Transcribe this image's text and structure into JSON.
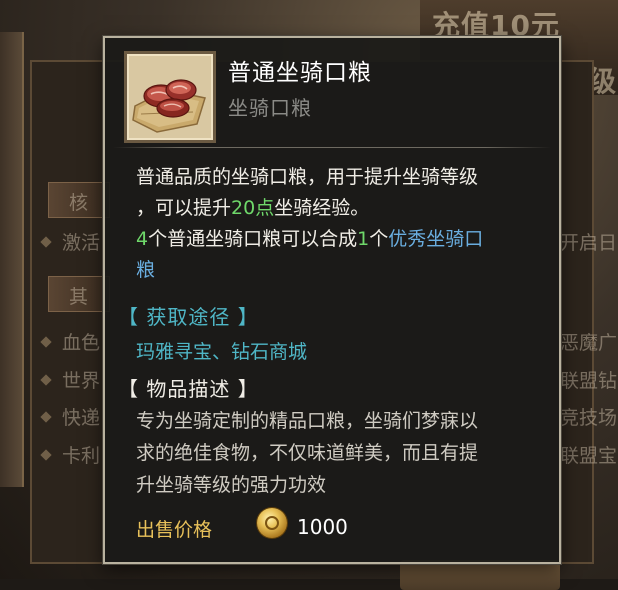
{
  "tooltip": {
    "name": "普通坐骑口粮",
    "type": "坐骑口粮",
    "description": {
      "line1": "普通品质的坐骑口粮，用于提升坐骑等级",
      "line2_pre": "，可以提升",
      "line2_points": "20点",
      "line2_post": "坐骑经验。",
      "line3_count_a": "4",
      "line3_mid": "个普通坐骑口粮可以合成",
      "line3_count_b": "1",
      "line3_unit": "个",
      "line3_link": "优秀坐骑口",
      "line4_link": "粮"
    },
    "acquire_heading": "【 获取途径 】",
    "acquire_sources": "玛雅寻宝、钻石商城",
    "item_desc_heading": "【 物品描述 】",
    "flavor_lines": [
      "专为坐骑定制的精品口粮，坐骑们梦寐以",
      "求的绝佳食物，不仅味道鲜美，而且有提",
      "升坐骑等级的强力功效"
    ],
    "price_label": "出售价格",
    "price_value": "1000",
    "icons": {
      "item": "meat-ration-icon",
      "currency": "gold-coin-icon"
    },
    "colors": {
      "highlight_green": "#6fd86a",
      "link_blue": "#6aaee0",
      "section_cyan": "#4fb6c6",
      "price_gold": "#e8c15a"
    }
  },
  "background": {
    "banner_title": "充值10元",
    "banner_sub": "升级",
    "section_labels": [
      "核",
      "其"
    ],
    "left_rows": [
      "激活",
      "血色",
      "世界",
      "快递",
      "卡利"
    ],
    "right_rows": [
      "开启日",
      "恶魔广",
      "联盟钻",
      "竞技场",
      "联盟宝"
    ]
  }
}
